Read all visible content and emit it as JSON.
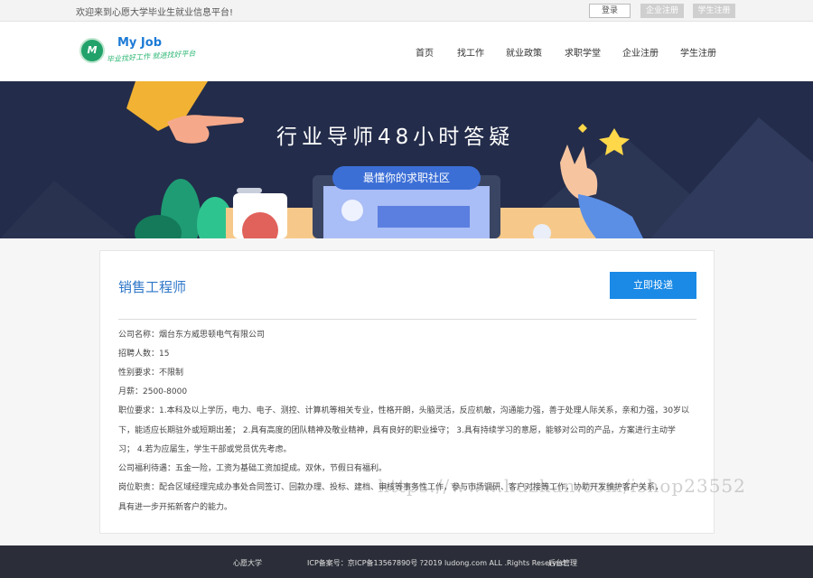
{
  "topbar": {
    "welcome": "欢迎来到心愿大学毕业生就业信息平台!",
    "login": "登录",
    "company_register": "企业注册",
    "student_register": "学生注册"
  },
  "header": {
    "logo_title": "My Job",
    "logo_slogan": "毕业找好工作 就进找好平台",
    "nav": [
      "首页",
      "找工作",
      "就业政策",
      "求职学堂",
      "企业注册",
      "学生注册"
    ]
  },
  "banner": {
    "title": "行业导师48小时答疑",
    "pill": "最懂你的求职社区"
  },
  "job": {
    "title": "销售工程师",
    "apply": "立即投递",
    "company": "公司名称：烟台东方威思顿电气有限公司",
    "headcount": "招聘人数：15",
    "gender": "性别要求：不限制",
    "salary": "月薪：2500-8000",
    "requirements_1": "职位要求：1.本科及以上学历，电力、电子、测控、计算机等相关专业，性格开朗，头脑灵活，反应机敏，沟通能力强，善于处理人际关系，亲和力强，30岁以",
    "requirements_2": "下，能适应长期驻外或短期出差； 2.具有高度的团队精神及敬业精神，具有良好的职业操守； 3.具有持续学习的意愿，能够对公司的产品，方案进行主动学",
    "requirements_3": "习； 4.若为应届生，学生干部或党员优先考虑。",
    "benefits": "公司福利待遇：五金一险，工资为基础工资加提成。双休，节假日有福利。",
    "duties_1": "岗位职责：配合区域经理完成办事处合同签订、回款办理、投标、建档、审核等事务性工作，参与市场调研、客户对接等工作，协助开发维护客户关系，",
    "duties_2": "具有进一步开拓新客户的能力。"
  },
  "watermark": "https://www.huzhan.com/ishop23552",
  "footer": {
    "school": "心愿大学",
    "icp": "ICP备案号：京ICP备13567890号 ?2019 ludong.com ALL .Rights Reserved",
    "admin": "后台管理"
  }
}
